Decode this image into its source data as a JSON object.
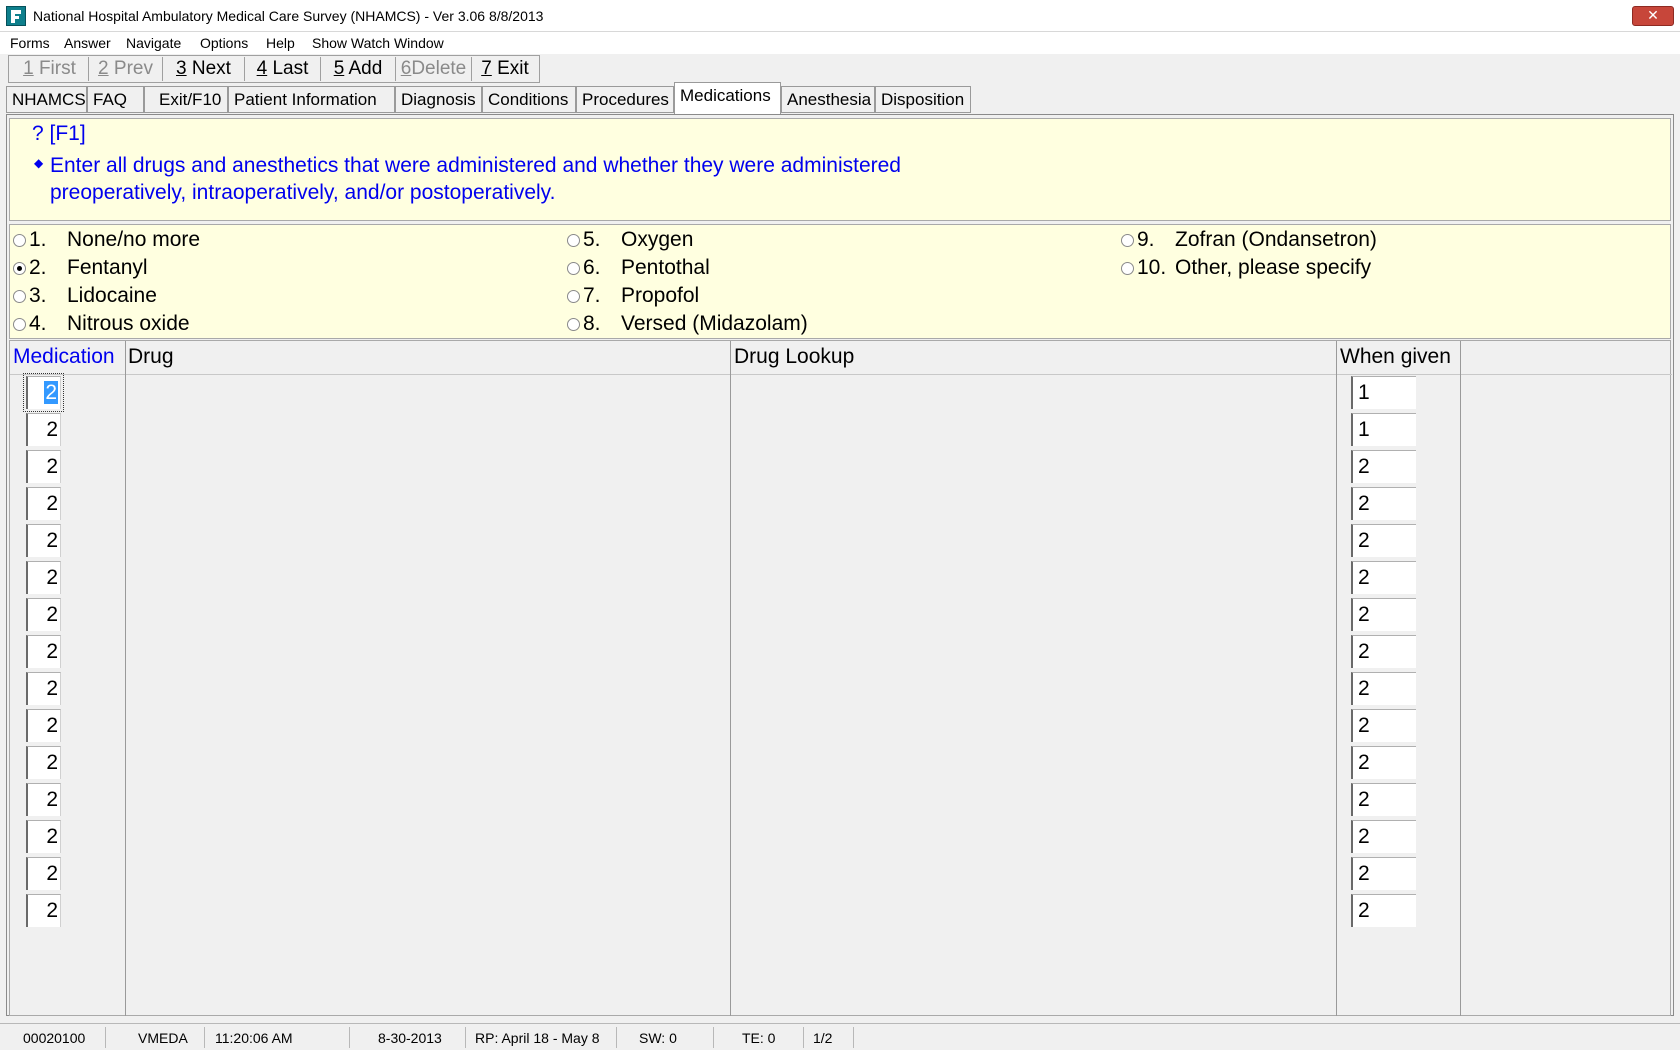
{
  "window": {
    "title": "National Hospital Ambulatory Medical Care Survey (NHAMCS) - Ver 3.06 8/8/2013",
    "close_glyph": "✕"
  },
  "menu": [
    "Forms",
    "Answer",
    "Navigate",
    "Options",
    "Help",
    "Show Watch Window"
  ],
  "toolbar": [
    {
      "key": "1",
      "label": "First",
      "enabled": false
    },
    {
      "key": "2",
      "label": "Prev",
      "enabled": false
    },
    {
      "key": "3",
      "label": "Next",
      "enabled": true
    },
    {
      "key": "4",
      "label": "Last",
      "enabled": true
    },
    {
      "key": "5",
      "label": "Add",
      "enabled": true
    },
    {
      "key": "6",
      "label": "Delete",
      "enabled": false
    },
    {
      "key": "7",
      "label": "Exit",
      "enabled": true
    }
  ],
  "tabs": [
    "NHAMCS",
    "FAQ",
    "Exit/F10",
    "Patient Information",
    "Diagnosis",
    "Conditions",
    "Procedures",
    "Medications",
    "Anesthesia",
    "Disposition"
  ],
  "active_tab": "Medications",
  "question": {
    "help": "? [F1]",
    "bullet": "◆",
    "text": "Enter all drugs and anesthetics that were administered and whether they were administered preoperatively, intraoperatively, and/or postoperatively."
  },
  "options": [
    {
      "num": "1.",
      "label": "None/no more",
      "checked": false
    },
    {
      "num": "2.",
      "label": "Fentanyl",
      "checked": true
    },
    {
      "num": "3.",
      "label": "Lidocaine",
      "checked": false
    },
    {
      "num": "4.",
      "label": "Nitrous oxide",
      "checked": false
    },
    {
      "num": "5.",
      "label": "Oxygen",
      "checked": false
    },
    {
      "num": "6.",
      "label": "Pentothal",
      "checked": false
    },
    {
      "num": "7.",
      "label": "Propofol",
      "checked": false
    },
    {
      "num": "8.",
      "label": "Versed (Midazolam)",
      "checked": false
    },
    {
      "num": "9.",
      "label": "Zofran (Ondansetron)",
      "checked": false
    },
    {
      "num": "10.",
      "label": "Other, please specify",
      "checked": false
    }
  ],
  "grid": {
    "headers": {
      "medication": "Medication",
      "drug": "Drug",
      "drug_lookup": "Drug Lookup",
      "when_given": "When given"
    },
    "rows": [
      {
        "medication": "2",
        "when_given": "1"
      },
      {
        "medication": "2",
        "when_given": "1"
      },
      {
        "medication": "2",
        "when_given": "2"
      },
      {
        "medication": "2",
        "when_given": "2"
      },
      {
        "medication": "2",
        "when_given": "2"
      },
      {
        "medication": "2",
        "when_given": "2"
      },
      {
        "medication": "2",
        "when_given": "2"
      },
      {
        "medication": "2",
        "when_given": "2"
      },
      {
        "medication": "2",
        "when_given": "2"
      },
      {
        "medication": "2",
        "when_given": "2"
      },
      {
        "medication": "2",
        "when_given": "2"
      },
      {
        "medication": "2",
        "when_given": "2"
      },
      {
        "medication": "2",
        "when_given": "2"
      },
      {
        "medication": "2",
        "when_given": "2"
      },
      {
        "medication": "2",
        "when_given": "2"
      }
    ]
  },
  "status_bar": [
    "00020100",
    "VMEDA",
    "11:20:06 AM",
    "8-30-2013",
    "RP: April 18  -  May 8",
    "SW: 0",
    "TE: 0",
    "1/2"
  ]
}
